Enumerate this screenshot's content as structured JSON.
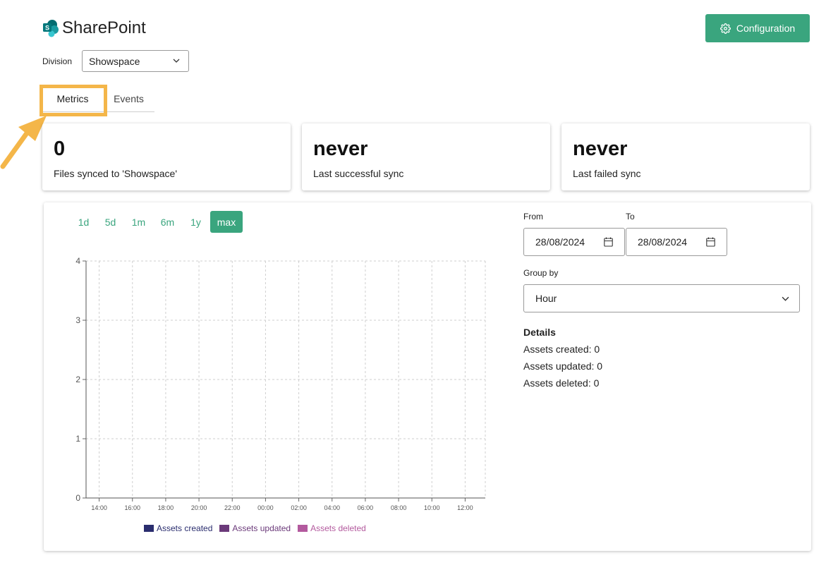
{
  "app": {
    "title": "SharePoint",
    "logo_icon": "sharepoint-logo-icon"
  },
  "header": {
    "config_button": {
      "label": "Configuration",
      "icon": "gear-icon"
    }
  },
  "division": {
    "label": "Division",
    "value": "Showspace"
  },
  "tabs": [
    {
      "label": "Metrics",
      "active": true
    },
    {
      "label": "Events",
      "active": false
    }
  ],
  "stats": [
    {
      "value": "0",
      "label": "Files synced to 'Showspace'"
    },
    {
      "value": "never",
      "label": "Last successful sync"
    },
    {
      "value": "never",
      "label": "Last failed sync"
    }
  ],
  "time_ranges": [
    {
      "label": "1d",
      "active": false
    },
    {
      "label": "5d",
      "active": false
    },
    {
      "label": "1m",
      "active": false
    },
    {
      "label": "6m",
      "active": false
    },
    {
      "label": "1y",
      "active": false
    },
    {
      "label": "max",
      "active": true
    }
  ],
  "filters": {
    "from_label": "From",
    "from_value": "28/08/2024",
    "to_label": "To",
    "to_value": "28/08/2024",
    "group_by_label": "Group by",
    "group_by_value": "Hour"
  },
  "details": {
    "title": "Details",
    "lines": [
      "Assets created: 0",
      "Assets updated: 0",
      "Assets deleted: 0"
    ]
  },
  "colors": {
    "accent": "#3aa57e",
    "highlight": "#f4b649",
    "series_created": "#2a2d6e",
    "series_updated": "#6b3a7a",
    "series_deleted": "#b35a9e"
  },
  "chart_data": {
    "type": "bar",
    "categories": [
      "14:00",
      "16:00",
      "18:00",
      "20:00",
      "22:00",
      "00:00",
      "02:00",
      "04:00",
      "06:00",
      "08:00",
      "10:00",
      "12:00"
    ],
    "series": [
      {
        "name": "Assets created",
        "values": [
          0,
          0,
          0,
          0,
          0,
          0,
          0,
          0,
          0,
          0,
          0,
          0
        ]
      },
      {
        "name": "Assets updated",
        "values": [
          0,
          0,
          0,
          0,
          0,
          0,
          0,
          0,
          0,
          0,
          0,
          0
        ]
      },
      {
        "name": "Assets deleted",
        "values": [
          0,
          0,
          0,
          0,
          0,
          0,
          0,
          0,
          0,
          0,
          0,
          0
        ]
      }
    ],
    "yticks": [
      "0",
      "1",
      "2",
      "3",
      "4"
    ],
    "ylim": [
      0,
      4
    ],
    "grid": true,
    "legend": "bottom"
  }
}
